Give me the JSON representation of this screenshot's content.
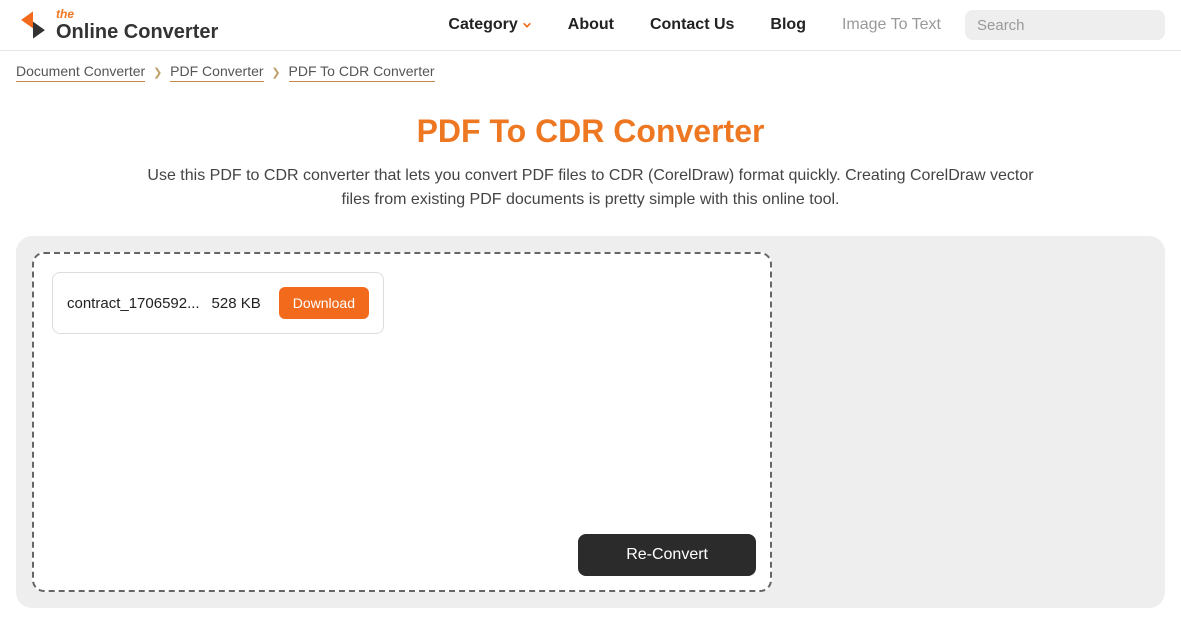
{
  "logo": {
    "the": "the",
    "main": "Online Converter"
  },
  "nav": {
    "category": "Category",
    "about": "About",
    "contact": "Contact Us",
    "blog": "Blog",
    "image_to_text": "Image To Text"
  },
  "search": {
    "placeholder": "Search"
  },
  "breadcrumb": {
    "a": "Document Converter",
    "b": "PDF Converter",
    "c": "PDF To CDR Converter"
  },
  "page": {
    "title": "PDF To CDR Converter",
    "description": "Use this PDF to CDR converter that lets you convert PDF files to CDR (CorelDraw) format quickly. Creating CorelDraw vector files from existing PDF documents is pretty simple with this online tool."
  },
  "file": {
    "name": "contract_1706592...",
    "size": "528 KB",
    "download": "Download"
  },
  "actions": {
    "reconvert": "Re-Convert"
  }
}
